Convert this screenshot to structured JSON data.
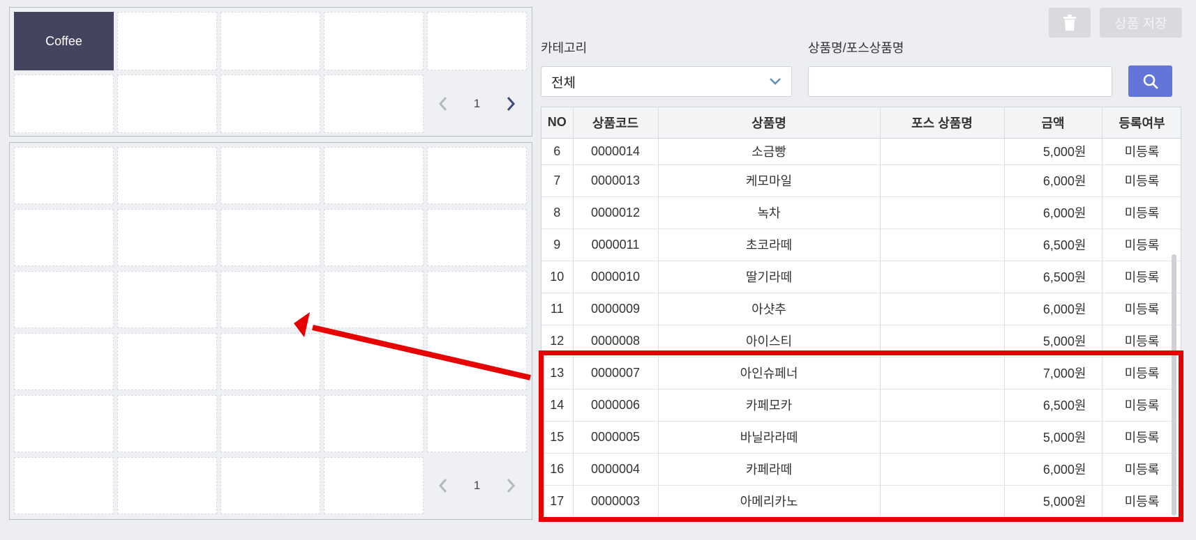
{
  "category_grid": {
    "active_label": "Coffee",
    "page": "1"
  },
  "product_grid": {
    "page": "1"
  },
  "toolbar": {
    "delete_icon": "trash-icon",
    "save_label": "상품 저장"
  },
  "filters": {
    "category_label": "카테고리",
    "category_value": "전체",
    "name_label": "상품명/포스상품명",
    "search_value": "",
    "search_icon": "search-icon"
  },
  "table": {
    "headers": [
      "NO",
      "상품코드",
      "상품명",
      "포스 상품명",
      "금액",
      "등록여부"
    ],
    "rows": [
      {
        "no": "6",
        "code": "0000014",
        "name": "소금빵",
        "pos_name": "",
        "price": "5,000원",
        "status": "미등록"
      },
      {
        "no": "7",
        "code": "0000013",
        "name": "케모마일",
        "pos_name": "",
        "price": "6,000원",
        "status": "미등록"
      },
      {
        "no": "8",
        "code": "0000012",
        "name": "녹차",
        "pos_name": "",
        "price": "6,000원",
        "status": "미등록"
      },
      {
        "no": "9",
        "code": "0000011",
        "name": "초코라떼",
        "pos_name": "",
        "price": "6,500원",
        "status": "미등록"
      },
      {
        "no": "10",
        "code": "0000010",
        "name": "딸기라떼",
        "pos_name": "",
        "price": "6,500원",
        "status": "미등록"
      },
      {
        "no": "11",
        "code": "0000009",
        "name": "아샷추",
        "pos_name": "",
        "price": "6,000원",
        "status": "미등록"
      },
      {
        "no": "12",
        "code": "0000008",
        "name": "아이스티",
        "pos_name": "",
        "price": "5,000원",
        "status": "미등록"
      },
      {
        "no": "13",
        "code": "0000007",
        "name": "아인슈페너",
        "pos_name": "",
        "price": "7,000원",
        "status": "미등록"
      },
      {
        "no": "14",
        "code": "0000006",
        "name": "카페모카",
        "pos_name": "",
        "price": "6,500원",
        "status": "미등록"
      },
      {
        "no": "15",
        "code": "0000005",
        "name": "바닐라라떼",
        "pos_name": "",
        "price": "5,000원",
        "status": "미등록"
      },
      {
        "no": "16",
        "code": "0000004",
        "name": "카페라떼",
        "pos_name": "",
        "price": "6,000원",
        "status": "미등록"
      },
      {
        "no": "17",
        "code": "0000003",
        "name": "아메리카노",
        "pos_name": "",
        "price": "5,000원",
        "status": "미등록"
      }
    ]
  },
  "annotation": {
    "color": "#e60000"
  }
}
